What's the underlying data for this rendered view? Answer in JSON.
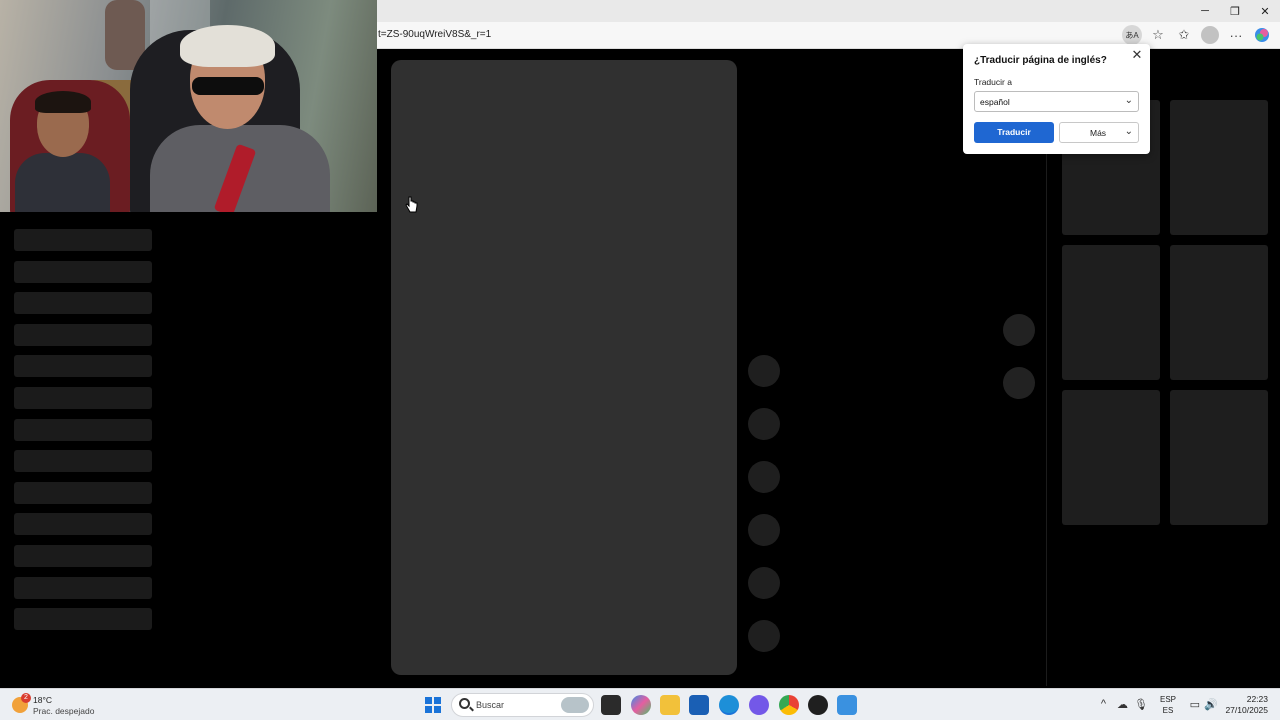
{
  "browser": {
    "url": "t=ZS-90uqWreiV8S&_r=1",
    "window_controls": {
      "minimize": "─",
      "restore": "❐",
      "close": "✕"
    },
    "toolbar_icons": [
      "translate-icon",
      "star-icon",
      "favorites-icon",
      "profile-icon",
      "more-icon",
      "copilot-icon"
    ],
    "more_glyph": "···",
    "star_glyph": "☆",
    "favorites_glyph": "✩",
    "translate_glyph": "あA"
  },
  "translate_popup": {
    "title": "¿Traducir página de inglés?",
    "label": "Traducir a",
    "selected_language": "español",
    "translate_button": "Traducir",
    "more_button": "Más",
    "close_glyph": "✕",
    "chevron_glyph": "⌄"
  },
  "taskbar": {
    "weather": {
      "temperature": "18°C",
      "description": "Prac. despejado",
      "badge": "2"
    },
    "search_placeholder": "Buscar",
    "language": {
      "code": "ESP",
      "region": "ES"
    },
    "clock": {
      "time": "22:23",
      "date": "27/10/2025"
    },
    "tray_chevron": "^"
  },
  "colors": {
    "accent": "#1f67d2",
    "page_bg": "#000000",
    "card": "#303030"
  }
}
